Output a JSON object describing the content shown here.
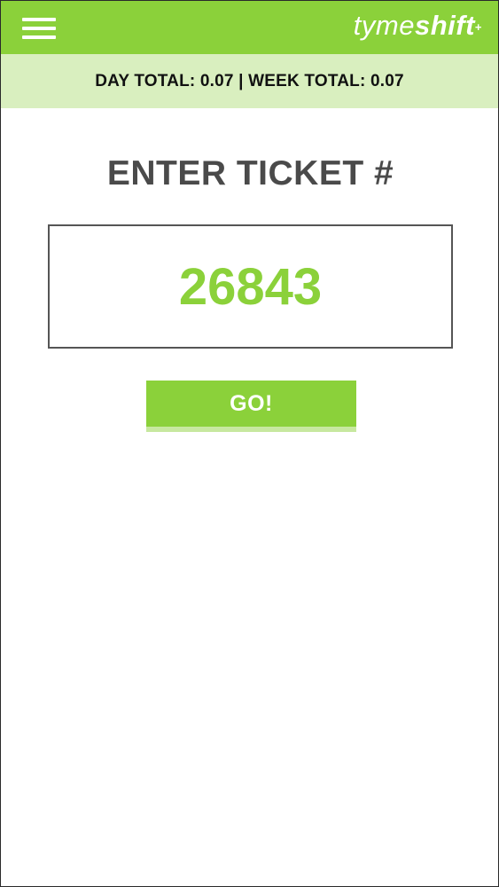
{
  "app": {
    "logo_light": "tyme",
    "logo_bold": "shift",
    "logo_mark": "+",
    "menu_icon": "hamburger-menu-icon",
    "brand_color": "#8bd13a"
  },
  "totals": {
    "text": "DAY TOTAL: 0.07 | WEEK TOTAL: 0.07"
  },
  "ticket": {
    "title": "ENTER TICKET #",
    "value": "26843"
  },
  "actions": {
    "go_label": "GO!"
  }
}
